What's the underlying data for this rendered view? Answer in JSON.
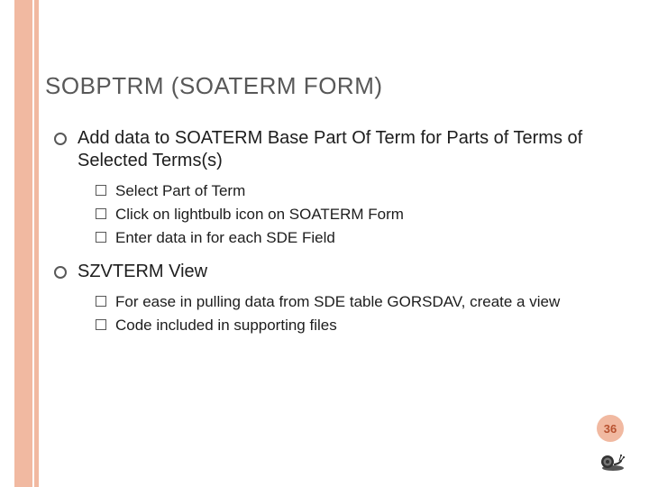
{
  "title": "SOBPTRM (SOATERM FORM)",
  "items": [
    {
      "label": "Add data to SOATERM Base Part Of Term for Parts of Terms of Selected Terms(s)",
      "sub": [
        "Select Part of Term",
        "Click on lightbulb icon on SOATERM Form",
        "Enter data in for each SDE Field"
      ]
    },
    {
      "label": "SZVTERM View",
      "sub": [
        "For ease in pulling data from SDE table GORSDAV, create a view",
        "Code included in supporting files"
      ]
    }
  ],
  "page": "36"
}
